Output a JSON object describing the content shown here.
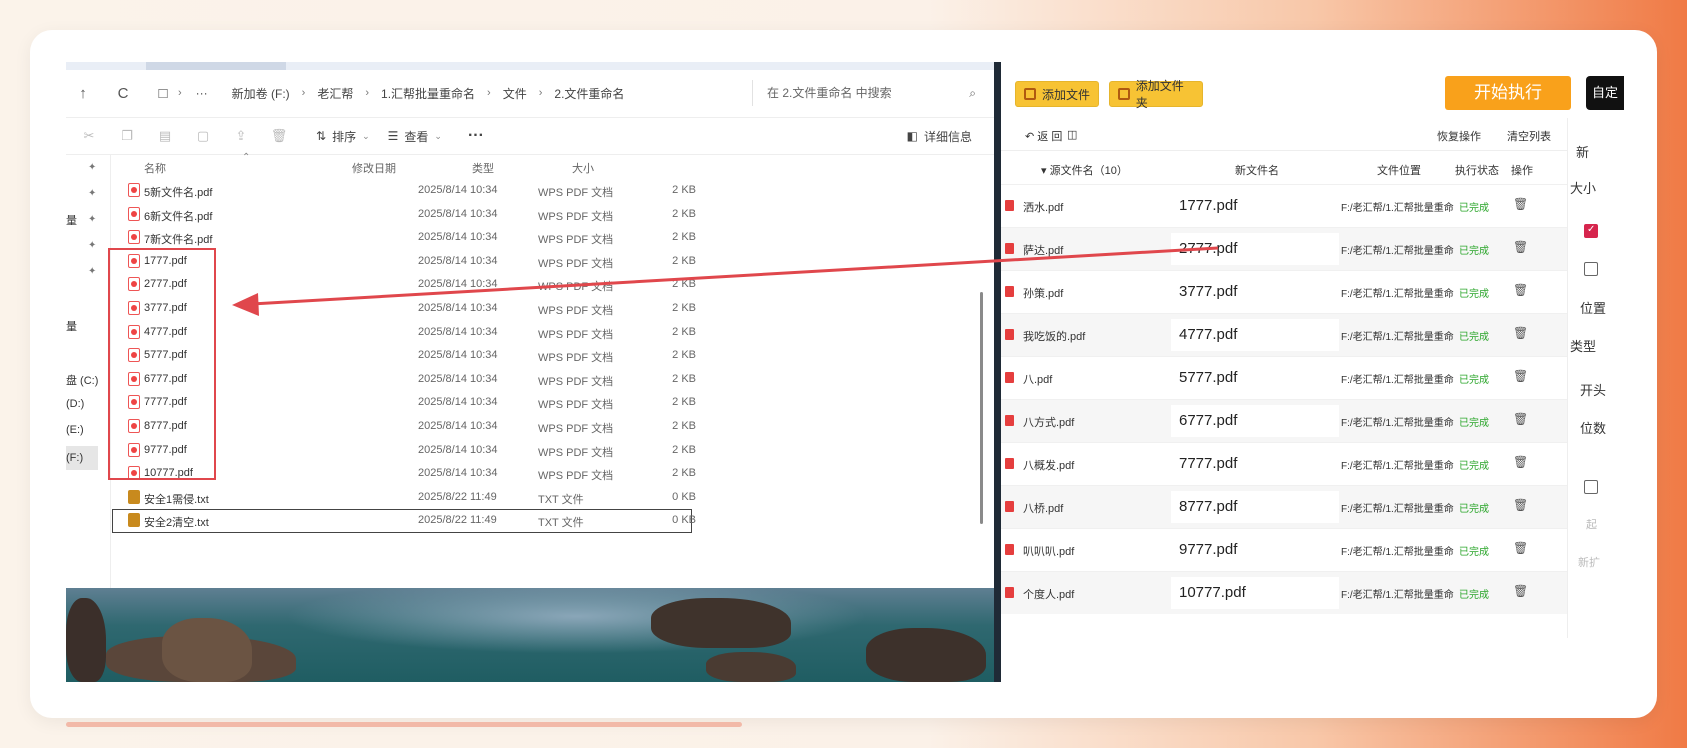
{
  "explorer": {
    "nav": {
      "up": "↑",
      "refresh": "C",
      "monitor": "□",
      "chev": "›",
      "more": "···"
    },
    "breadcrumbs": [
      "新加卷 (F:)",
      "老汇帮",
      "1.汇帮批量重命名",
      "文件",
      "2.文件重命名"
    ],
    "search_placeholder": "在 2.文件重命名 中搜索",
    "toolbar": {
      "sort": "排序",
      "view": "查看",
      "more": "···",
      "details": "详细信息"
    },
    "side_drives": [
      "盘 (C:)",
      "(D:)",
      "(E:)",
      "(F:)"
    ],
    "side_marks": [
      "量",
      "量"
    ],
    "columns": {
      "name": "名称",
      "date": "修改日期",
      "type": "类型",
      "size": "大小"
    },
    "files": [
      {
        "name": "5新文件名.pdf",
        "date": "2025/8/14 10:34",
        "type": "WPS PDF 文档",
        "size": "2 KB",
        "kind": "pdf"
      },
      {
        "name": "6新文件名.pdf",
        "date": "2025/8/14 10:34",
        "type": "WPS PDF 文档",
        "size": "2 KB",
        "kind": "pdf"
      },
      {
        "name": "7新文件名.pdf",
        "date": "2025/8/14 10:34",
        "type": "WPS PDF 文档",
        "size": "2 KB",
        "kind": "pdf"
      },
      {
        "name": "1777.pdf",
        "date": "2025/8/14 10:34",
        "type": "WPS PDF 文档",
        "size": "2 KB",
        "kind": "pdf"
      },
      {
        "name": "2777.pdf",
        "date": "2025/8/14 10:34",
        "type": "WPS PDF 文档",
        "size": "2 KB",
        "kind": "pdf"
      },
      {
        "name": "3777.pdf",
        "date": "2025/8/14 10:34",
        "type": "WPS PDF 文档",
        "size": "2 KB",
        "kind": "pdf"
      },
      {
        "name": "4777.pdf",
        "date": "2025/8/14 10:34",
        "type": "WPS PDF 文档",
        "size": "2 KB",
        "kind": "pdf"
      },
      {
        "name": "5777.pdf",
        "date": "2025/8/14 10:34",
        "type": "WPS PDF 文档",
        "size": "2 KB",
        "kind": "pdf"
      },
      {
        "name": "6777.pdf",
        "date": "2025/8/14 10:34",
        "type": "WPS PDF 文档",
        "size": "2 KB",
        "kind": "pdf"
      },
      {
        "name": "7777.pdf",
        "date": "2025/8/14 10:34",
        "type": "WPS PDF 文档",
        "size": "2 KB",
        "kind": "pdf"
      },
      {
        "name": "8777.pdf",
        "date": "2025/8/14 10:34",
        "type": "WPS PDF 文档",
        "size": "2 KB",
        "kind": "pdf"
      },
      {
        "name": "9777.pdf",
        "date": "2025/8/14 10:34",
        "type": "WPS PDF 文档",
        "size": "2 KB",
        "kind": "pdf"
      },
      {
        "name": "10777.pdf",
        "date": "2025/8/14 10:34",
        "type": "WPS PDF 文档",
        "size": "2 KB",
        "kind": "pdf"
      },
      {
        "name": "安全1需侵.txt",
        "date": "2025/8/22 11:49",
        "type": "TXT 文件",
        "size": "0 KB",
        "kind": "txt"
      },
      {
        "name": "安全2清空.txt",
        "date": "2025/8/22 11:49",
        "type": "TXT 文件",
        "size": "0 KB",
        "kind": "txt"
      }
    ]
  },
  "tool": {
    "add_file": "添加文件",
    "add_folder": "添加文件夹",
    "start": "开始执行",
    "auto": "自定",
    "back": "返 回",
    "restore": "恢复操作",
    "clear": "清空列表",
    "columns": {
      "src": "▾ 源文件名（10）",
      "new": "新文件名",
      "loc": "文件位置",
      "status": "执行状态",
      "op": "操作"
    },
    "rows": [
      {
        "src": "洒水.pdf",
        "new": "1777.pdf",
        "loc": "F:/老汇帮/1.汇帮批量重命",
        "status": "已完成"
      },
      {
        "src": "萨达.pdf",
        "new": "2777.pdf",
        "loc": "F:/老汇帮/1.汇帮批量重命",
        "status": "已完成"
      },
      {
        "src": "孙策.pdf",
        "new": "3777.pdf",
        "loc": "F:/老汇帮/1.汇帮批量重命",
        "status": "已完成"
      },
      {
        "src": "我吃饭的.pdf",
        "new": "4777.pdf",
        "loc": "F:/老汇帮/1.汇帮批量重命",
        "status": "已完成"
      },
      {
        "src": "八.pdf",
        "new": "5777.pdf",
        "loc": "F:/老汇帮/1.汇帮批量重命",
        "status": "已完成"
      },
      {
        "src": "八方式.pdf",
        "new": "6777.pdf",
        "loc": "F:/老汇帮/1.汇帮批量重命",
        "status": "已完成"
      },
      {
        "src": "八概发.pdf",
        "new": "7777.pdf",
        "loc": "F:/老汇帮/1.汇帮批量重命",
        "status": "已完成"
      },
      {
        "src": "八桥.pdf",
        "new": "8777.pdf",
        "loc": "F:/老汇帮/1.汇帮批量重命",
        "status": "已完成"
      },
      {
        "src": "叭叭叭.pdf",
        "new": "9777.pdf",
        "loc": "F:/老汇帮/1.汇帮批量重命",
        "status": "已完成"
      },
      {
        "src": "个度人.pdf",
        "new": "10777.pdf",
        "loc": "F:/老汇帮/1.汇帮批量重命",
        "status": "已完成"
      }
    ],
    "side": [
      "新",
      "大小",
      "位置",
      "类型",
      "开头",
      "位数",
      "起",
      "新扩"
    ]
  },
  "colors": {
    "accent_yellow": "#f7c334",
    "start_orange": "#f9a11b",
    "done_green": "#2aa52a",
    "red_arrow": "#e0474c"
  }
}
